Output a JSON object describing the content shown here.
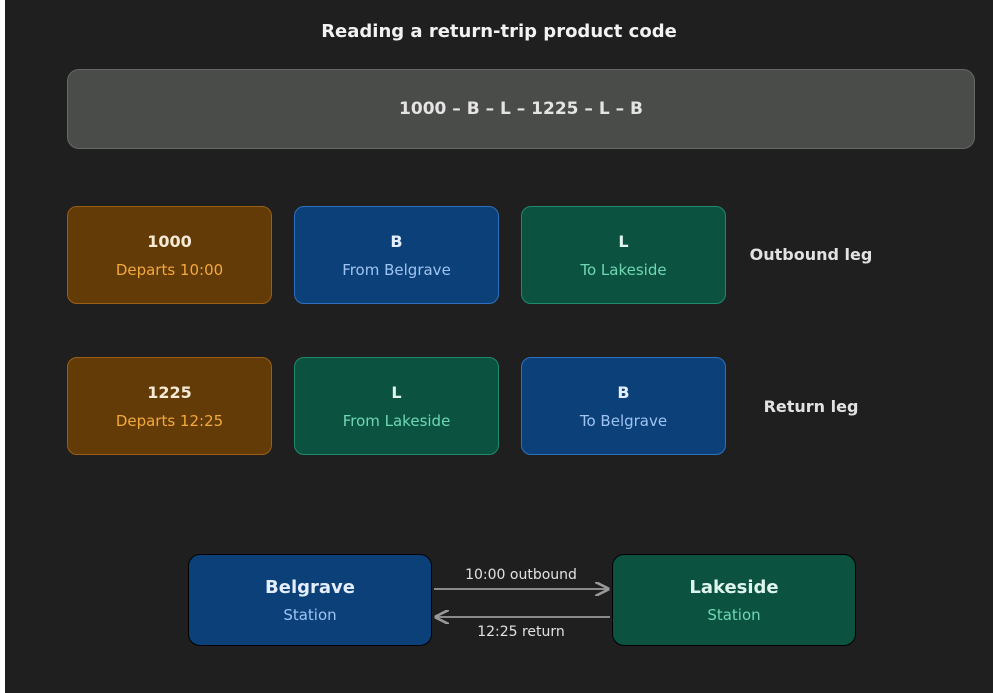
{
  "title": "Reading a return-trip product code",
  "code": "1000 – B – L – 1225 – L – B",
  "outbound": {
    "label": "Outbound leg",
    "segments": [
      {
        "main": "1000",
        "sub": "Departs 10:00",
        "color": "amber"
      },
      {
        "main": "B",
        "sub": "From Belgrave",
        "color": "blue"
      },
      {
        "main": "L",
        "sub": "To Lakeside",
        "color": "green"
      }
    ]
  },
  "return": {
    "label": "Return leg",
    "segments": [
      {
        "main": "1225",
        "sub": "Departs 12:25",
        "color": "amber"
      },
      {
        "main": "L",
        "sub": "From Lakeside",
        "color": "green"
      },
      {
        "main": "B",
        "sub": "To Belgrave",
        "color": "blue"
      }
    ]
  },
  "stations": {
    "left": {
      "name": "Belgrave",
      "sub": "Station"
    },
    "right": {
      "name": "Lakeside",
      "sub": "Station"
    }
  },
  "arrows": {
    "outbound": "10:00 outbound",
    "return": "12:25 return"
  },
  "colors": {
    "amber": "#633b07",
    "blue": "#0c4079",
    "green": "#0b5240",
    "background": "#1f1f1f"
  }
}
